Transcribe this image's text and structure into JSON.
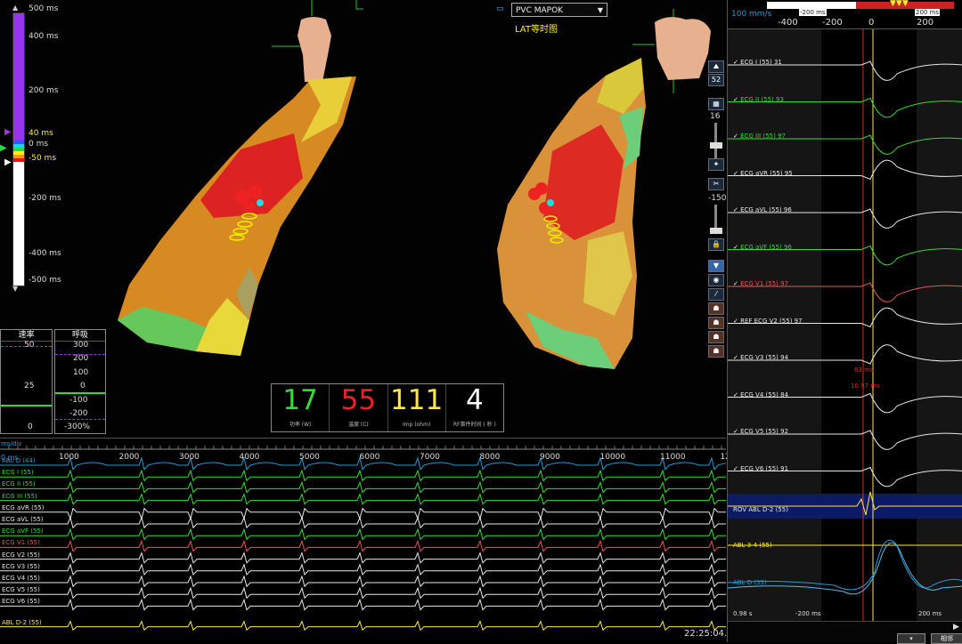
{
  "colors": {
    "accent_yellow": "#ffea3a",
    "purple": "#9a33ee",
    "green": "#33dd33",
    "red": "#ee2222",
    "blue": "#2a9ad4",
    "white": "#e8e8e8"
  },
  "lat_scale": {
    "labels": [
      "500 ms",
      "400 ms",
      "200 ms",
      "40 ms",
      "0 ms",
      "-50 ms",
      "-200 ms",
      "-400 ms",
      "-500 ms"
    ]
  },
  "map_view": {
    "select_value": "PVC MAPOK",
    "title": "LAT等时图"
  },
  "side_tools": {
    "value1": "52",
    "value2": "16",
    "value3": "-150"
  },
  "rate_panel": {
    "title": "速率",
    "ticks": [
      "50",
      "25",
      "0"
    ]
  },
  "resp_panel": {
    "title": "呼吸",
    "ticks": [
      "300",
      "200",
      "100",
      "0",
      "-100",
      "-200",
      "-300%"
    ]
  },
  "metrics": [
    {
      "value": "17",
      "label": "功率 (W)",
      "color": "#33dd33"
    },
    {
      "value": "55",
      "label": "温度 (C)",
      "color": "#ee2222"
    },
    {
      "value": "111",
      "label": "Imp (ohm)",
      "color": "#ffea3a"
    },
    {
      "value": "4",
      "label": "RF事件时间 ( 秒 )",
      "color": "#ffffff"
    }
  ],
  "egm_strip": {
    "top_label": "ms/div",
    "zero_label": "0 ms",
    "time_ticks": [
      "1000",
      "2000",
      "3000",
      "4000",
      "5000",
      "6000",
      "7000",
      "8000",
      "9000",
      "10000",
      "11000",
      "120"
    ],
    "channels": [
      {
        "label": "ABL D (44)",
        "color": "#2a9ad4"
      },
      {
        "label": "ECG I (55)",
        "color": "#33dd33"
      },
      {
        "label": "ECG II (55)",
        "color": "#33dd33"
      },
      {
        "label": "ECG III (55)",
        "color": "#33dd33"
      },
      {
        "label": "ECG aVR (55)",
        "color": "#e8e8e8"
      },
      {
        "label": "ECG aVL (55)",
        "color": "#e8e8e8"
      },
      {
        "label": "ECG aVF (55)",
        "color": "#33dd33"
      },
      {
        "label": "ECG V1 (55)",
        "color": "#ee5555"
      },
      {
        "label": "ECG V2 (55)",
        "color": "#e8e8e8"
      },
      {
        "label": "ECG V3 (55)",
        "color": "#e8e8e8"
      },
      {
        "label": "ECG V4 (55)",
        "color": "#e8e8e8"
      },
      {
        "label": "ECG V5 (55)",
        "color": "#e8e8e8"
      },
      {
        "label": "ECG V6 (55)",
        "color": "#e8e8e8"
      },
      {
        "label": "ABL D-2 (55)",
        "color": "#ffea3a"
      }
    ],
    "clock": "22:25:04."
  },
  "right_panel": {
    "speed": "100 mm/s",
    "scroll_left": "-200 ms",
    "scroll_right": "200 ms",
    "axis": [
      "-400",
      "-200",
      "0",
      "200"
    ],
    "channels": [
      {
        "label": "ECG I (55)",
        "value": "31",
        "color": "#e8e8e8"
      },
      {
        "label": "ECG II (55)",
        "value": "93",
        "color": "#33dd33"
      },
      {
        "label": "ECG III (55)",
        "value": "97",
        "color": "#33dd33"
      },
      {
        "label": "ECG aVR (55)",
        "value": "95",
        "color": "#e8e8e8"
      },
      {
        "label": "ECG aVL (55)",
        "value": "96",
        "color": "#e8e8e8"
      },
      {
        "label": "ECG aVF (55)",
        "value": "96",
        "color": "#33dd33"
      },
      {
        "label": "ECG V1 (55)",
        "value": "97",
        "color": "#ee5555"
      },
      {
        "label": "REF ECG V2 (55)",
        "value": "97",
        "color": "#e8e8e8"
      },
      {
        "label": "ECG V3 (55)",
        "value": "94",
        "color": "#e8e8e8"
      },
      {
        "label": "ECG V4 (55)",
        "value": "84",
        "color": "#e8e8e8"
      },
      {
        "label": "ECG V5 (55)",
        "value": "92",
        "color": "#e8e8e8"
      },
      {
        "label": "ECG V6 (55)",
        "value": "91",
        "color": "#e8e8e8"
      }
    ],
    "roi_label": "ROV ABL D-2 (55)",
    "abl34_label": "ABL 3-4 (55)",
    "abl_d_label": "ABL D (55)",
    "annot1": "63 ms",
    "annot2": "10.97 ms",
    "bottom_left": "0.98 s",
    "bottom_m200": "-200 ms",
    "bottom_200": "200 ms",
    "bottom_btn": "相邻"
  }
}
